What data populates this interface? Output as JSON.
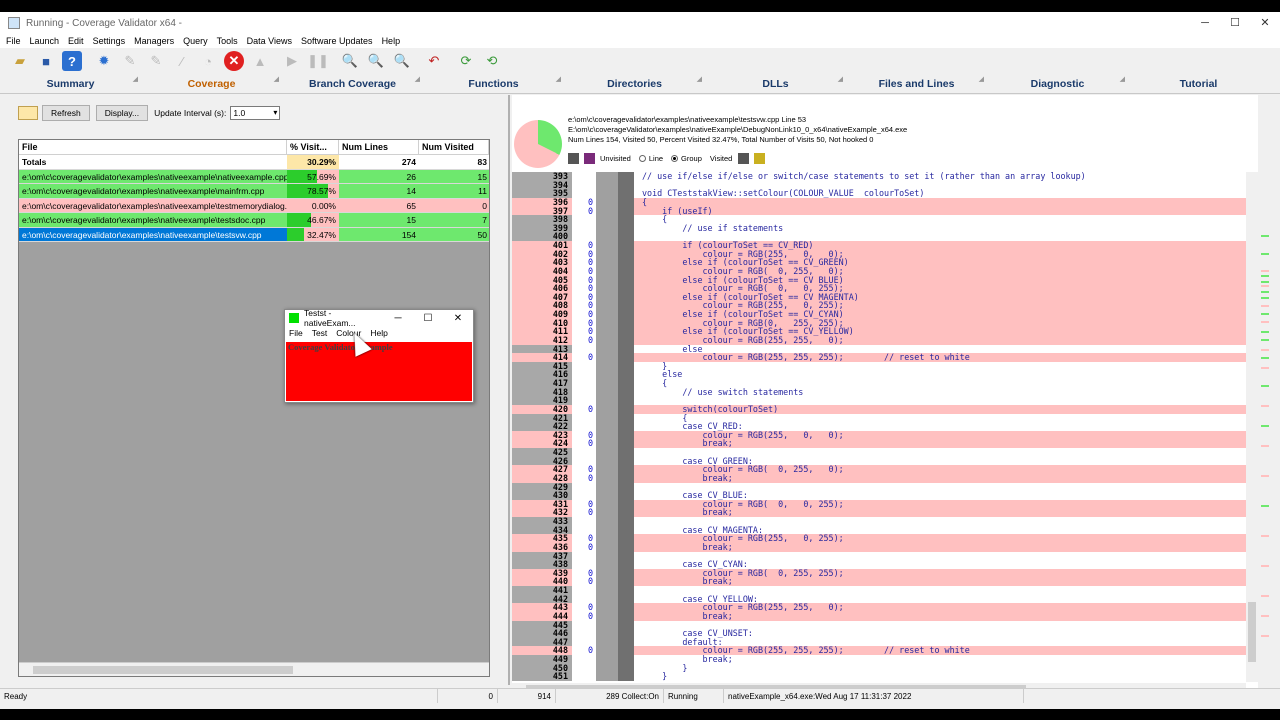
{
  "window": {
    "title": "Running - Coverage Validator x64 -",
    "controls": [
      "─",
      "☐",
      "✕"
    ]
  },
  "menu": [
    "File",
    "Launch",
    "Edit",
    "Settings",
    "Managers",
    "Query",
    "Tools",
    "Data Views",
    "Software Updates",
    "Help"
  ],
  "tabs": [
    {
      "label": "Summary"
    },
    {
      "label": "Coverage"
    },
    {
      "label": "Branch Coverage"
    },
    {
      "label": "Functions"
    },
    {
      "label": "Directories"
    },
    {
      "label": "DLLs"
    },
    {
      "label": "Files and Lines"
    },
    {
      "label": "Diagnostic"
    },
    {
      "label": "Tutorial"
    }
  ],
  "controls": {
    "refresh": "Refresh",
    "display": "Display...",
    "update_label": "Update Interval (s):",
    "update_value": "1.0"
  },
  "table": {
    "headers": [
      "File",
      "% Visit...",
      "Num Lines",
      "Num Visited"
    ],
    "totals": {
      "file": "Totals",
      "pct": "30.29%",
      "lines": "274",
      "visited": "83"
    },
    "rows": [
      {
        "file": "e:\\om\\c\\coveragevalidator\\examples\\nativeexample\\nativeexample.cpp",
        "pct": "57.69%",
        "pct_value": 57.69,
        "lines": "26",
        "visited": "15"
      },
      {
        "file": "e:\\om\\c\\coveragevalidator\\examples\\nativeexample\\mainfrm.cpp",
        "pct": "78.57%",
        "pct_value": 78.57,
        "lines": "14",
        "visited": "11"
      },
      {
        "file": "e:\\om\\c\\coveragevalidator\\examples\\nativeexample\\testmemorydialog...",
        "pct": "0.00%",
        "pct_value": 0,
        "lines": "65",
        "visited": "0"
      },
      {
        "file": "e:\\om\\c\\coveragevalidator\\examples\\nativeexample\\testsdoc.cpp",
        "pct": "46.67%",
        "pct_value": 46.67,
        "lines": "15",
        "visited": "7"
      },
      {
        "file": "e:\\om\\c\\coveragevalidator\\examples\\nativeexample\\testsvw.cpp",
        "pct": "32.47%",
        "pct_value": 32.47,
        "lines": "154",
        "visited": "50"
      }
    ]
  },
  "detail": {
    "line1": "e:\\om\\c\\coveragevalidator\\examples\\nativeexample\\testsvw.cpp Line 53",
    "line2": "E:\\om\\c\\coverageValidator\\examples\\nativeExample\\DebugNonLink10_0_x64\\nativeExample_x64.exe",
    "line3": "Num Lines  154, Visited     50, Percent Visited 32.47%, Total Number of Visits      50, Not hooked 0",
    "unvisited": "Unvisited",
    "line": "Line",
    "group": "Group",
    "visited": "Visited",
    "pie_percent": 32.47
  },
  "code": [
    {
      "n": "393",
      "c": "",
      "t": "// use if/else if/else or switch/case statements to set it (rather than an array lookup)",
      "h": false
    },
    {
      "n": "394",
      "c": "",
      "t": "",
      "h": false
    },
    {
      "n": "395",
      "c": "",
      "t": "void CTeststakView::setColour(COLOUR_VALUE  colourToSet)",
      "h": false
    },
    {
      "n": "396",
      "c": "0",
      "t": "{",
      "h": true
    },
    {
      "n": "397",
      "c": "0",
      "t": "    if (useIf)",
      "h": true
    },
    {
      "n": "398",
      "c": "",
      "t": "    {",
      "h": false
    },
    {
      "n": "399",
      "c": "",
      "t": "        // use if statements",
      "h": false
    },
    {
      "n": "400",
      "c": "",
      "t": "",
      "h": false
    },
    {
      "n": "401",
      "c": "0",
      "t": "        if (colourToSet == CV_RED)",
      "h": true
    },
    {
      "n": "402",
      "c": "0",
      "t": "            colour = RGB(255,   0,   0);",
      "h": true
    },
    {
      "n": "403",
      "c": "0",
      "t": "        else if (colourToSet == CV_GREEN)",
      "h": true
    },
    {
      "n": "404",
      "c": "0",
      "t": "            colour = RGB(  0, 255,   0);",
      "h": true
    },
    {
      "n": "405",
      "c": "0",
      "t": "        else if (colourToSet == CV_BLUE)",
      "h": true
    },
    {
      "n": "406",
      "c": "0",
      "t": "            colour = RGB(  0,   0, 255);",
      "h": true
    },
    {
      "n": "407",
      "c": "0",
      "t": "        else if (colourToSet == CV_MAGENTA)",
      "h": true
    },
    {
      "n": "408",
      "c": "0",
      "t": "            colour = RGB(255,   0, 255);",
      "h": true
    },
    {
      "n": "409",
      "c": "0",
      "t": "        else if (colourToSet == CV_CYAN)",
      "h": true
    },
    {
      "n": "410",
      "c": "0",
      "t": "            colour = RGB(0,   255, 255);",
      "h": true
    },
    {
      "n": "411",
      "c": "0",
      "t": "        else if (colourToSet == CV_YELLOW)",
      "h": true
    },
    {
      "n": "412",
      "c": "0",
      "t": "            colour = RGB(255, 255,   0);",
      "h": true
    },
    {
      "n": "413",
      "c": "",
      "t": "        else",
      "h": false
    },
    {
      "n": "414",
      "c": "0",
      "t": "            colour = RGB(255, 255, 255);        // reset to white",
      "h": true
    },
    {
      "n": "415",
      "c": "",
      "t": "    }",
      "h": false
    },
    {
      "n": "416",
      "c": "",
      "t": "    else",
      "h": false
    },
    {
      "n": "417",
      "c": "",
      "t": "    {",
      "h": false
    },
    {
      "n": "418",
      "c": "",
      "t": "        // use switch statements",
      "h": false
    },
    {
      "n": "419",
      "c": "",
      "t": "",
      "h": false
    },
    {
      "n": "420",
      "c": "0",
      "t": "        switch(colourToSet)",
      "h": true
    },
    {
      "n": "421",
      "c": "",
      "t": "        {",
      "h": false
    },
    {
      "n": "422",
      "c": "",
      "t": "        case CV_RED:",
      "h": false
    },
    {
      "n": "423",
      "c": "0",
      "t": "            colour = RGB(255,   0,   0);",
      "h": true
    },
    {
      "n": "424",
      "c": "0",
      "t": "            break;",
      "h": true
    },
    {
      "n": "425",
      "c": "",
      "t": "",
      "h": false
    },
    {
      "n": "426",
      "c": "",
      "t": "        case CV_GREEN:",
      "h": false
    },
    {
      "n": "427",
      "c": "0",
      "t": "            colour = RGB(  0, 255,   0);",
      "h": true
    },
    {
      "n": "428",
      "c": "0",
      "t": "            break;",
      "h": true
    },
    {
      "n": "429",
      "c": "",
      "t": "",
      "h": false
    },
    {
      "n": "430",
      "c": "",
      "t": "        case CV_BLUE:",
      "h": false
    },
    {
      "n": "431",
      "c": "0",
      "t": "            colour = RGB(  0,   0, 255);",
      "h": true
    },
    {
      "n": "432",
      "c": "0",
      "t": "            break;",
      "h": true
    },
    {
      "n": "433",
      "c": "",
      "t": "",
      "h": false
    },
    {
      "n": "434",
      "c": "",
      "t": "        case CV_MAGENTA:",
      "h": false
    },
    {
      "n": "435",
      "c": "0",
      "t": "            colour = RGB(255,   0, 255);",
      "h": true
    },
    {
      "n": "436",
      "c": "0",
      "t": "            break;",
      "h": true
    },
    {
      "n": "437",
      "c": "",
      "t": "",
      "h": false
    },
    {
      "n": "438",
      "c": "",
      "t": "        case CV_CYAN:",
      "h": false
    },
    {
      "n": "439",
      "c": "0",
      "t": "            colour = RGB(  0, 255, 255);",
      "h": true
    },
    {
      "n": "440",
      "c": "0",
      "t": "            break;",
      "h": true
    },
    {
      "n": "441",
      "c": "",
      "t": "",
      "h": false
    },
    {
      "n": "442",
      "c": "",
      "t": "        case CV_YELLOW:",
      "h": false
    },
    {
      "n": "443",
      "c": "0",
      "t": "            colour = RGB(255, 255,   0);",
      "h": true
    },
    {
      "n": "444",
      "c": "0",
      "t": "            break;",
      "h": true
    },
    {
      "n": "445",
      "c": "",
      "t": "",
      "h": false
    },
    {
      "n": "446",
      "c": "",
      "t": "        case CV_UNSET:",
      "h": false
    },
    {
      "n": "447",
      "c": "",
      "t": "        default:",
      "h": false
    },
    {
      "n": "448",
      "c": "0",
      "t": "            colour = RGB(255, 255, 255);        // reset to white",
      "h": true
    },
    {
      "n": "449",
      "c": "",
      "t": "            break;",
      "h": false
    },
    {
      "n": "450",
      "c": "",
      "t": "        }",
      "h": false
    },
    {
      "n": "451",
      "c": "",
      "t": "    }",
      "h": false
    }
  ],
  "status": {
    "ready": "Ready",
    "a": "0",
    "b": "914",
    "c": "289 Collect:On",
    "d": "Running",
    "e": "nativeExample_x64.exe:Wed Aug 17 11:31:37 2022"
  },
  "popup": {
    "title": "Testst - nativeExam...",
    "menu": [
      "File",
      "Test",
      "Colour",
      "Help"
    ],
    "body": "Coverage Validator Example"
  },
  "colors": {
    "visited": "#6ee86e",
    "unvisited": "#ffc0c0",
    "selection": "#0078d7",
    "accent_tab": "#c06000"
  }
}
